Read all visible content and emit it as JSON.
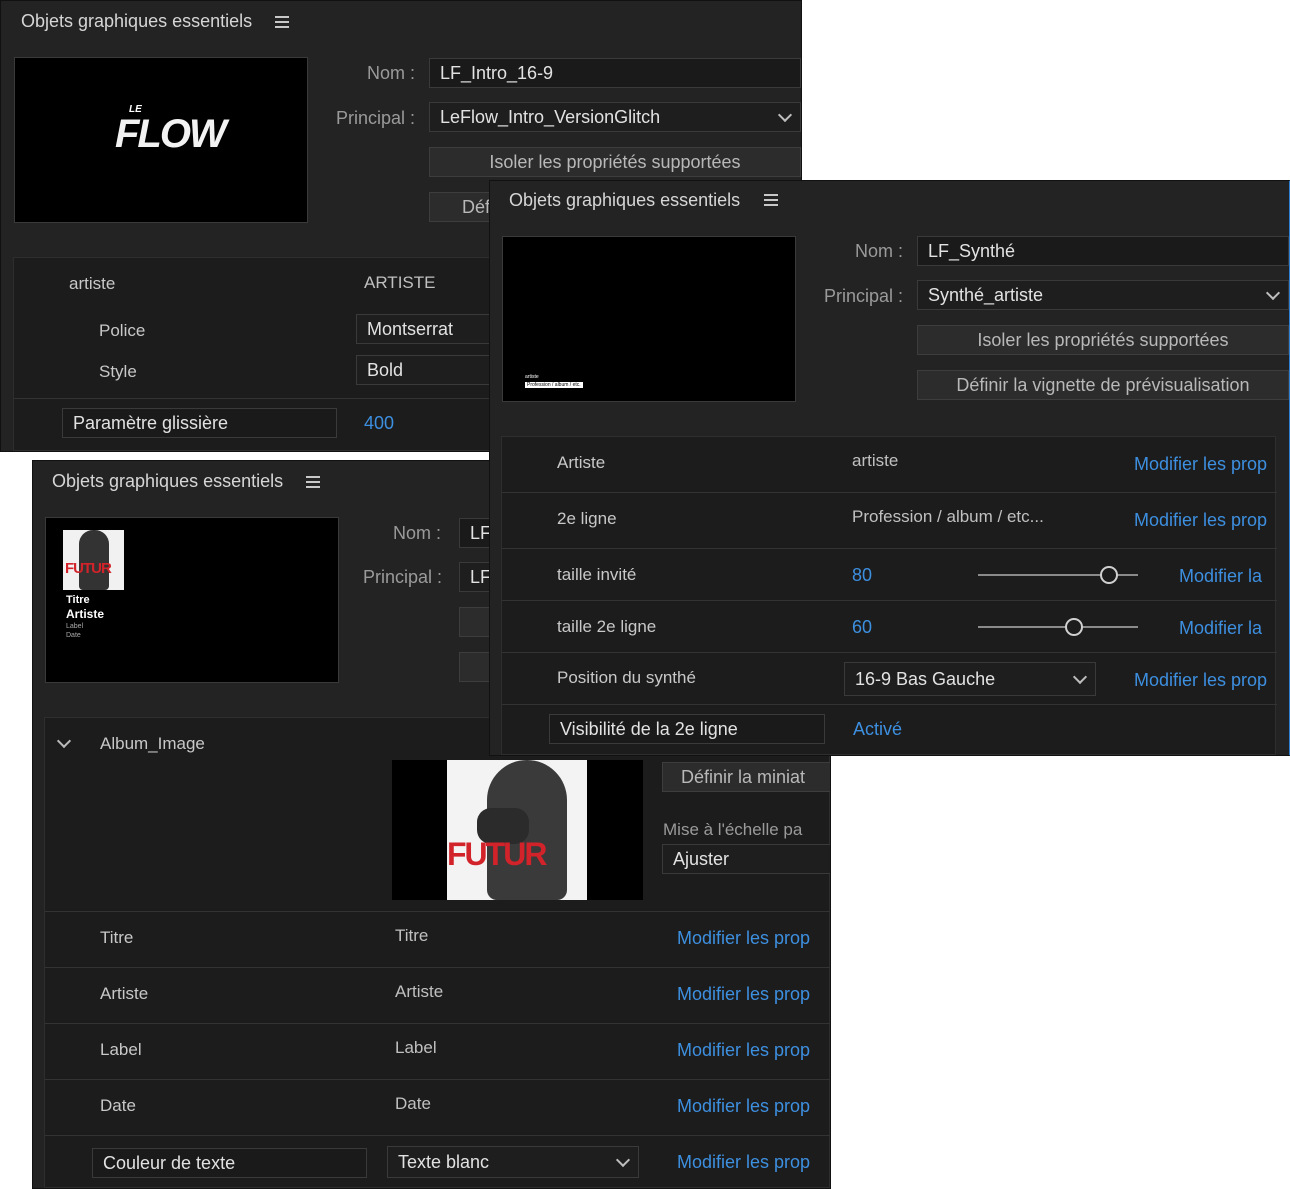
{
  "panel1": {
    "title": "Objets graphiques essentiels",
    "thumb_logo_small": "LE",
    "thumb_logo_big": "FLOW",
    "nom_label": "Nom :",
    "nom_value": "LF_Intro_16-9",
    "principal_label": "Principal :",
    "principal_value": "LeFlow_Intro_VersionGlitch",
    "isoler_button": "Isoler les propriétés supportées",
    "definir_button": "Défi",
    "row_artiste_label": "artiste",
    "row_artiste_value": "ARTISTE",
    "police_label": "Police",
    "police_value": "Montserrat",
    "style_label": "Style",
    "style_value": "Bold",
    "slider_param_label": "Paramètre glissière",
    "slider_param_value": "400"
  },
  "panel2": {
    "title": "Objets graphiques essentiels",
    "nom_label": "Nom :",
    "nom_value": "LF_Synthé",
    "principal_label": "Principal :",
    "principal_value": "Synthé_artiste",
    "isoler_button": "Isoler les propriétés supportées",
    "definir_button": "Définir la vignette de prévisualisation",
    "thumb_line1": "artiste",
    "thumb_line2": "Profession / album / etc.",
    "rows": [
      {
        "label": "Artiste",
        "value": "artiste",
        "link": "Modifier les prop"
      },
      {
        "label": "2e ligne",
        "value": "Profession / album / etc...",
        "link": "Modifier les prop"
      },
      {
        "label": "taille invité",
        "value": "80",
        "link": "Modifier la",
        "slider": 0.82
      },
      {
        "label": "taille 2e ligne",
        "value": "60",
        "link": "Modifier la",
        "slider": 0.6
      },
      {
        "label": "Position du synthé",
        "value": "16-9 Bas Gauche",
        "link": "Modifier les prop"
      }
    ],
    "visibilite_label": "Visibilité de la 2e ligne",
    "visibilite_value": "Activé"
  },
  "panel3": {
    "title": "Objets graphiques essentiels",
    "nom_label": "Nom :",
    "nom_value": "LF",
    "principal_label": "Principal :",
    "principal_value": "LF",
    "thumb_futur": "FUTUR",
    "thumb_titre": "Titre",
    "thumb_artiste": "Artiste",
    "thumb_label": "Label",
    "thumb_date": "Date",
    "album_label": "Album_Image",
    "album_futur": "FUTUR",
    "definir_miniature": "Définir la miniat",
    "mise_echelle_label": "Mise à l'échelle pa",
    "mise_echelle_value": "Ajuster",
    "rows": [
      {
        "label": "Titre",
        "value": "Titre",
        "link": "Modifier les prop"
      },
      {
        "label": "Artiste",
        "value": "Artiste",
        "link": "Modifier les prop"
      },
      {
        "label": "Label",
        "value": "Label",
        "link": "Modifier les prop"
      },
      {
        "label": "Date",
        "value": "Date",
        "link": "Modifier les prop"
      }
    ],
    "couleur_label": "Couleur de texte",
    "couleur_value": "Texte blanc",
    "couleur_link": "Modifier les prop"
  },
  "colors": {
    "panel_bg": "#232323",
    "accent_blue": "#3d8fe0",
    "futur_red": "#d2232a"
  }
}
